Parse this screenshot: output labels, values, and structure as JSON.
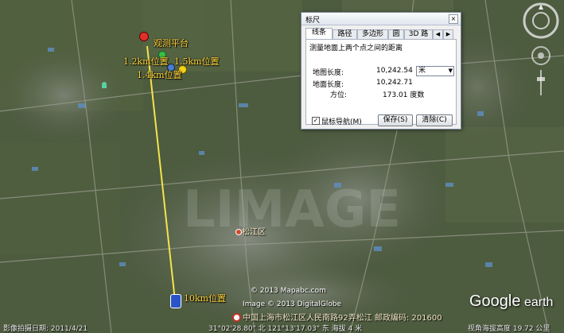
{
  "map": {
    "placemarks": {
      "platform": "观测平台",
      "km12": "1.2km位置",
      "km15": "1.5km位置",
      "km14": "1.4km位置",
      "km10": "10km位置",
      "songjiang": "松江区"
    },
    "address_line": "中国上海市松江区人民南路92弄松江 邮政编码: 201600",
    "watermark_credit": "© 2013 Mapabc.com",
    "image_credit": "Image © 2013 DigitalGlobe"
  },
  "ruler": {
    "title": "标尺",
    "close_label": "×",
    "tabs": [
      "线条",
      "路径",
      "多边形",
      "圆",
      "3D 路"
    ],
    "scroll_left": "◀",
    "scroll_right": "▶",
    "description": "测量地面上两个点之间的距离",
    "map_length_label": "地图长度:",
    "map_length_value": "10,242.54",
    "unit_selected": "米",
    "ground_length_label": "地面长度:",
    "ground_length_value": "10,242.71",
    "heading_label": "方位:",
    "heading_value": "173.01 度数",
    "mouse_nav_label": "鼠标导航(M)",
    "mouse_nav_checked": true,
    "save_label": "保存(S)",
    "clear_label": "清除(C)"
  },
  "status": {
    "imagery_date": "影像拍摄日期: 2011/4/21",
    "coords": "31°02'28.80\" 北  121°13'17.03\" 东  海拔  4 米",
    "eye_alt": "视角海拔高度  19.72 公里"
  },
  "logo": {
    "google": "Google",
    "earth": "earth"
  },
  "colors": {
    "measure_line": "#f4e44a",
    "label": "#ffd23a",
    "pin_red": "#e0302c",
    "pin_yellow": "#f6d317",
    "pin_green": "#3cc03c"
  },
  "icons": [
    "compass-icon",
    "look-joystick-icon",
    "move-joystick-icon",
    "zoom-slider-icon",
    "pushpin-icon",
    "person-icon",
    "close-icon"
  ]
}
